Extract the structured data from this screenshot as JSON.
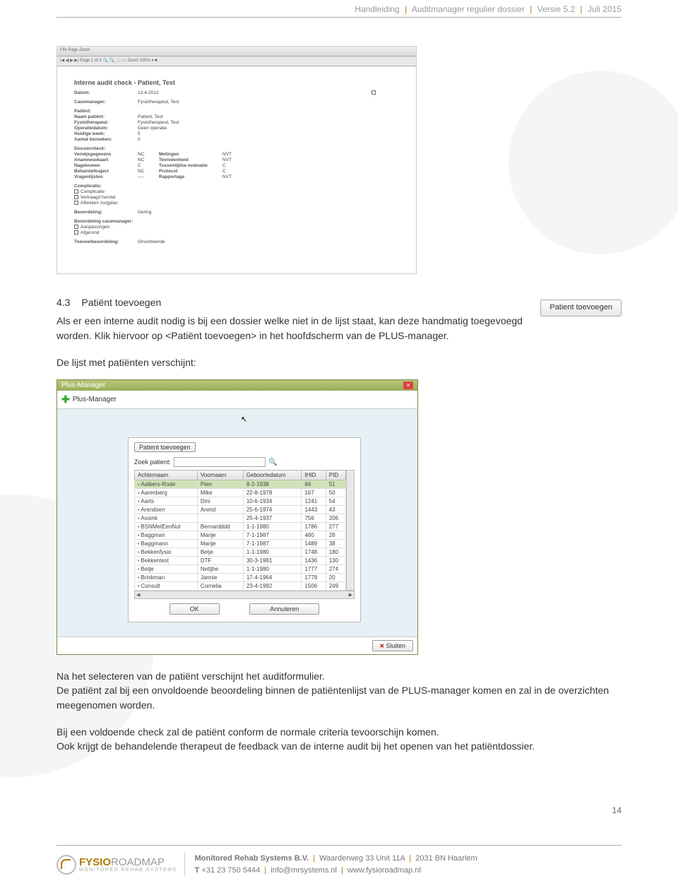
{
  "header": {
    "title": "Handleiding",
    "subtitle": "Auditmanager regulier dossier",
    "version": "Versie 5.2",
    "date": "Juli 2015"
  },
  "report": {
    "toolbar1": "File   Page   Zoom",
    "toolbar2": "|◀  ◀  ▶  ▶|   Page  1      of 2    🔍 🔍 ⬜ ▭  Zoom  100%  ▾  ■",
    "title": "Interne audit check - Patient, Test",
    "datum_lab": "Datum:",
    "datum_val": "12-4-2012",
    "case_lab": "Casemanager:",
    "case_val": "Fysiotherapeut, Test",
    "pat_hdr": "Patiënt:",
    "rows_left": [
      {
        "lab": "Naam patiënt:",
        "val": "Patient, Test"
      },
      {
        "lab": "Fysiotherapeut:",
        "val": "Fysiotherapeut, Test"
      },
      {
        "lab": "Operatiedatum:",
        "val": "Geen operatie"
      },
      {
        "lab": "Huidige week:",
        "val": "5"
      },
      {
        "lab": "Aantal bezoeken:",
        "val": "0"
      }
    ],
    "dossier_hdr": "Dossiercheck:",
    "dossier_rows": [
      {
        "a": "Verwijsgegevens",
        "av": "NC",
        "b": "Metingen",
        "bv": "NVT"
      },
      {
        "a": "Anamnesekaart",
        "av": "NC",
        "b": "Tevredenheid",
        "bv": "NVT"
      },
      {
        "a": "Nagekomen",
        "av": "C",
        "b": "Tussentijdse evaluatie",
        "bv": "C"
      },
      {
        "a": "Behandeltraject",
        "av": "NC",
        "b": "Protocol",
        "bv": "C"
      },
      {
        "a": "Vragenlijsten",
        "av": "----",
        "b": "Rapportage",
        "bv": "NVT"
      }
    ],
    "comp_hdr": "Complicatie:",
    "comp_items": [
      "Complicatie",
      "Vertraagd herstel",
      "Afbreken zorgplan"
    ],
    "beoord_lab": "Beoordeling:",
    "beoord_val": "Gering",
    "bcm_hdr": "Beoordeling casemanager:",
    "bcm_items": [
      "Aanpassingen",
      "Afgerond"
    ],
    "toe_lab": "Toevoelbeoordeling:",
    "toe_val": "Onvoldoende"
  },
  "section": {
    "num": "4.3",
    "title": "Patiënt toevoegen",
    "p1": "Als er een interne audit nodig is bij een dossier welke niet in de lijst staat, kan deze handmatig toegevoegd worden. Klik hiervoor op <Patiënt toevoegen> in het hoofdscherm van de PLUS-manager.",
    "button_img": "Patient toevoegen",
    "p2": "De lijst met patiënten verschijnt:",
    "p3": "Na het selecteren van de patiënt verschijnt het auditformulier.",
    "p4": "De patiënt zal bij een onvoldoende beoordeling binnen de patiëntenlijst van de PLUS-manager komen en zal in de overzichten meegenomen worden.",
    "p5": "Bij een voldoende check zal de patiënt conform de normale criteria tevoorschijn komen.",
    "p6": "Ook krijgt de behandelende therapeut de feedback van de interne audit bij het openen van het patiëntdossier."
  },
  "plus_manager": {
    "window_title": "Plus-Manager",
    "sub": "Plus-Manager",
    "pt_button": "Patient toevoegen",
    "search_label": "Zoek patient:",
    "columns": [
      "Achternaam",
      "Voornaam",
      "Geboortedatum",
      "IHID",
      "PID"
    ],
    "rows": [
      {
        "a": "Aalbers-Rode",
        "v": "Pien",
        "g": "8-2-1938",
        "i": "84",
        "p": "51",
        "sel": true
      },
      {
        "a": "Aarenberg",
        "v": "Mike",
        "g": "22-8-1978",
        "i": "167",
        "p": "50"
      },
      {
        "a": "Aarts",
        "v": "Dini",
        "g": "10-6-1934",
        "i": "1241",
        "p": "54"
      },
      {
        "a": "Arendsen",
        "v": "Arend",
        "g": "25-6-1974",
        "i": "1443",
        "p": "43"
      },
      {
        "a": "Assink",
        "v": "",
        "g": "25-4-1937",
        "i": "756",
        "p": "206"
      },
      {
        "a": "BSNMetEenNul",
        "v": "Bernardddd",
        "g": "1-1-1980",
        "i": "1786",
        "p": "277"
      },
      {
        "a": "Baggman",
        "v": "Marije",
        "g": "7-1-1987",
        "i": "460",
        "p": "28"
      },
      {
        "a": "Baggmann",
        "v": "Marije",
        "g": "7-1-1987",
        "i": "1489",
        "p": "38"
      },
      {
        "a": "Bekkenfysio",
        "v": "Betje",
        "g": "1-1-1980",
        "i": "1748",
        "p": "180"
      },
      {
        "a": "Bekkentest",
        "v": "DTF",
        "g": "30-3-1981",
        "i": "1436",
        "p": "130"
      },
      {
        "a": "Betje",
        "v": "Nettjhe",
        "g": "1-1-1980",
        "i": "1777",
        "p": "274"
      },
      {
        "a": "Brinkman",
        "v": "Jannie",
        "g": "17-4-1964",
        "i": "1778",
        "p": "20"
      },
      {
        "a": "Consult",
        "v": "Cornelia",
        "g": "23-4-1982",
        "i": "1506",
        "p": "249"
      }
    ],
    "ok": "OK",
    "cancel": "Annuleren",
    "close": "Sluiten"
  },
  "page_num": "14",
  "footer": {
    "brand_a": "FYSIO",
    "brand_b": "ROADMAP",
    "brand_sub": "MONITORED REHAB SYSTEMS",
    "company": "Monitored Rehab Systems B.V.",
    "addr": "Waarderweg 33 Unit 11A",
    "city": "2031 BN Haarlem",
    "tel_lab": "T",
    "tel": "+31 23 750 5444",
    "email": "info@mrsystems.nl",
    "web": "www.fysioroadmap.nl"
  }
}
